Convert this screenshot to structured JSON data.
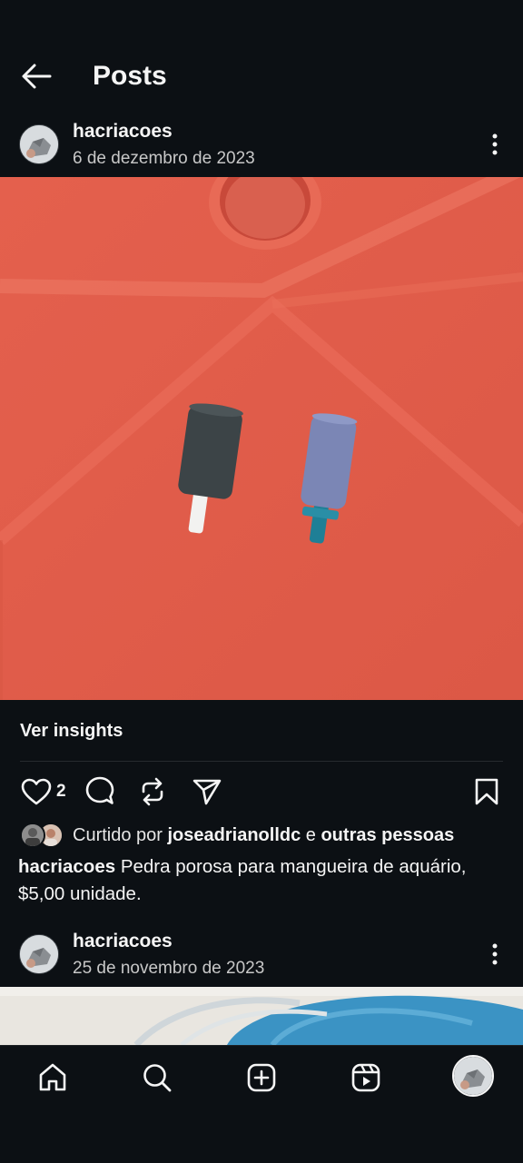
{
  "header": {
    "title": "Posts"
  },
  "post1": {
    "username": "hacriacoes",
    "date": "6 de dezembro de 2023",
    "insights_label": "Ver insights",
    "like_count": "2",
    "liked_by_prefix": "Curtido por",
    "liked_by_user": "joseadrianolldc",
    "liked_by_joiner": "e",
    "liked_by_others": "outras pessoas",
    "caption_user": "hacriacoes",
    "caption_text": "Pedra porosa para mangueira de aquário, $5,00 unidade."
  },
  "post2": {
    "username": "hacriacoes",
    "date": "25 de novembro de 2023"
  },
  "icons": {
    "back": "arrow-left-icon",
    "more": "more-vertical-icon",
    "like": "heart-icon",
    "comment": "comment-icon",
    "repost": "repost-icon",
    "share": "send-icon",
    "save": "bookmark-icon",
    "nav": [
      "home-icon",
      "search-icon",
      "create-icon",
      "reels-icon",
      "profile-avatar"
    ]
  },
  "colors": {
    "background": "#0c1014",
    "text": "#f5f5f5",
    "secondary_text": "#c8c8c8",
    "photo_background": "#e05d4b"
  }
}
